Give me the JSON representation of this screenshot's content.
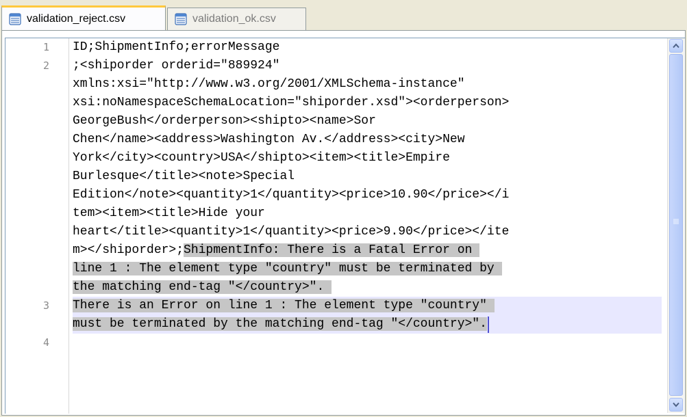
{
  "tabs": [
    {
      "label": "validation_reject.csv",
      "active": true
    },
    {
      "label": "validation_ok.csv",
      "active": false
    }
  ],
  "editor": {
    "line_numbers": [
      "1",
      "2",
      "3",
      "4"
    ],
    "lines": [
      {
        "plain": "ID;ShipmentInfo;errorMessage",
        "sel": ""
      },
      {
        "plain": ";<shiporder orderid=\"889924\"",
        "sel": ""
      },
      {
        "plain": "xmlns:xsi=\"http://www.w3.org/2001/XMLSchema-instance\"",
        "sel": ""
      },
      {
        "plain": "xsi:noNamespaceSchemaLocation=\"shiporder.xsd\"><orderperson>",
        "sel": ""
      },
      {
        "plain": "GeorgeBush</orderperson><shipto><name>Sor",
        "sel": ""
      },
      {
        "plain": "Chen</name><address>Washington Av.</address><city>New",
        "sel": ""
      },
      {
        "plain": "York</city><country>USA</shipto><item><title>Empire",
        "sel": ""
      },
      {
        "plain": "Burlesque</title><note>Special",
        "sel": ""
      },
      {
        "plain": "Edition</note><quantity>1</quantity><price>10.90</price></i",
        "sel": ""
      },
      {
        "plain": "tem><item><title>Hide your",
        "sel": ""
      },
      {
        "plain": "heart</title><quantity>1</quantity><price>9.90</price></ite",
        "sel": ""
      },
      {
        "plain": "m></shiporder>;",
        "sel": "ShipmentInfo: There is a Fatal Error on "
      },
      {
        "plain": "",
        "sel": "line 1 : The element type \"country\" must be terminated by "
      },
      {
        "plain": "",
        "sel": "the matching end-tag \"</country>\". "
      },
      {
        "plain": "",
        "sel": "There is an Error on line 1 : The element type \"country\" "
      },
      {
        "plain": "",
        "sel": "must be terminated by the matching end-tag \"</country>\"."
      },
      {
        "plain": "",
        "sel": ""
      }
    ]
  },
  "colors": {
    "selection": "#c6c6c6",
    "current_line": "#e8e8ff",
    "caret": "#5050d0",
    "tab_accent": "#ffc83c"
  },
  "icons": {
    "tab": "csv-file-icon",
    "scroll_up": "chevron-up-icon",
    "scroll_down": "chevron-down-icon"
  }
}
